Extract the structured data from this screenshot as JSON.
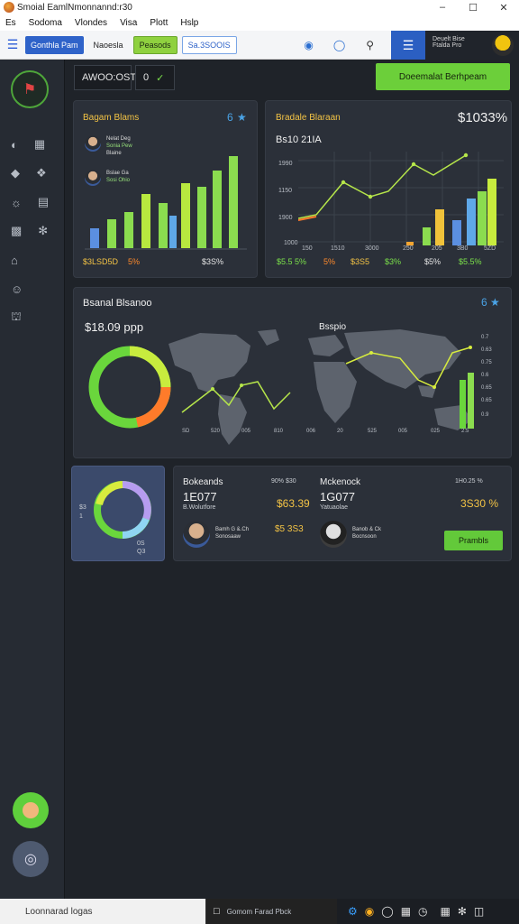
{
  "window": {
    "title": "Smoial EamlNmonnannd:r30",
    "controls": [
      "minimize-icon",
      "maximize-icon",
      "close-icon"
    ]
  },
  "menu": [
    "Es",
    "Sodoma",
    "Vlondes",
    "Visa",
    "Plott",
    "Hslp"
  ],
  "toolbar": {
    "btn1": "Gonthla Pam",
    "btn2": "Naoesla",
    "btn3": "Peasods",
    "btn4": "Sa.3SOOIS",
    "user_line1": "Deuelt Bise",
    "user_line2": "Ftalda Pro"
  },
  "controls": {
    "select_value": "AWOO:OST",
    "toggle": "0",
    "cta_label": "Doeemalat Berhpeam"
  },
  "card_left": {
    "title": "Bagam Blams",
    "icon": "6",
    "person1_name": "Nelat Deg",
    "person1_sub": "Sonia Pew",
    "person1_line3": "Blaine",
    "person2_name": "Bslae Ga",
    "person2_sub": "Sosi Ohio",
    "footer_a": "$3LSD5D",
    "footer_b": "5%",
    "footer_c": "$3S%",
    "accent": "#7be04a"
  },
  "card_right": {
    "title": "Bradale Blaraan",
    "value": "$1033%",
    "subtitle": "Bs10 21IA",
    "y_labels": [
      "1990",
      "1150",
      "1900",
      "1000"
    ],
    "x_labels": [
      "150",
      "1510",
      "3000",
      "250",
      "205",
      "3B0",
      "5ZD"
    ],
    "footer": [
      "$5.5 5%",
      "5%",
      "$3S5",
      "$3%",
      "$5%",
      "$5.5%"
    ]
  },
  "card_mid": {
    "title": "Bsanal Blsanoo",
    "icon": "6",
    "value": "$18.09 ppp",
    "map_label": "Bsspio",
    "y_labels": [
      "0.7",
      "0.63",
      "0.75",
      "0.6",
      "0.65",
      "0.65",
      "0.9"
    ],
    "x_labels": [
      "SD",
      "520",
      "005",
      "810",
      "006",
      "20",
      "525",
      "005",
      "025",
      "2:5"
    ]
  },
  "card_donut": {
    "left_val": "$3",
    "left_sub": "1",
    "bottom_val": "0S",
    "bottom_sub": "Q3"
  },
  "card_bottom": {
    "col1_title": "Bokeands",
    "col1_value": "1E077",
    "col1_sub": "B.Wolutfore",
    "col1_top": "90% $30",
    "col1_amount": "$63.39",
    "col2_title": "Mckenock",
    "col2_value": "1G077",
    "col2_sub": "Yatuaolae",
    "col2_top": "1H0.25 %",
    "col2_amount": "3S30 %",
    "p1_name": "Bamh G &.Ch",
    "p1_sub": "Sonosaaw",
    "p1_amount": "$5 3S3",
    "p2_name": "Banob & Ck",
    "p2_sub": "Bocnsoon",
    "btn": "Prambls"
  },
  "taskbar": {
    "search": "Loonnarad logas",
    "app": "Gomom Farad Pbck"
  }
}
